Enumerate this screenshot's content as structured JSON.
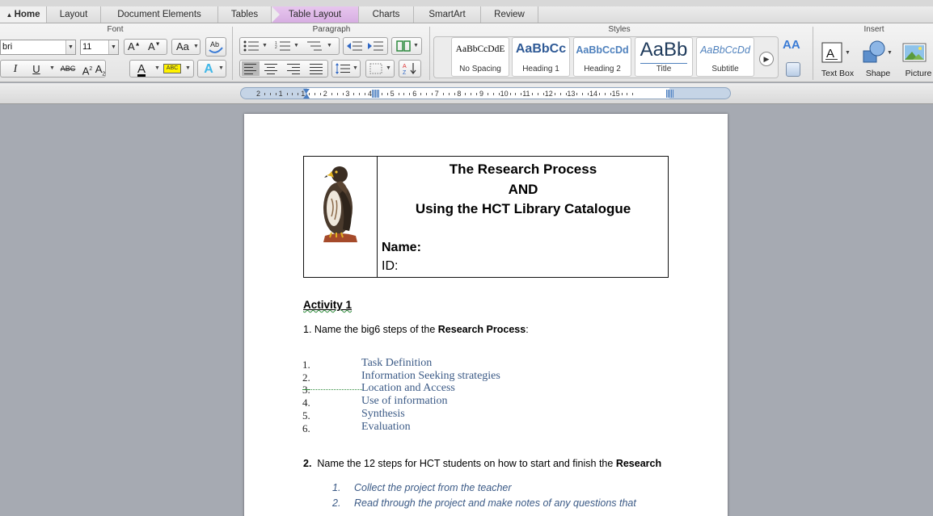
{
  "tabs": [
    {
      "label": "Home"
    },
    {
      "label": "Layout"
    },
    {
      "label": "Document Elements"
    },
    {
      "label": "Tables"
    },
    {
      "label": "Table Layout"
    },
    {
      "label": "Charts"
    },
    {
      "label": "SmartArt"
    },
    {
      "label": "Review"
    }
  ],
  "ribbon": {
    "groups": {
      "font": "Font",
      "paragraph": "Paragraph",
      "styles": "Styles",
      "insert": "Insert"
    },
    "font_name": "bri",
    "font_size": "11",
    "styles": [
      {
        "sample": "AaBbCcDdE",
        "name": "No Spacing"
      },
      {
        "sample": "AaBbCc",
        "name": "Heading 1"
      },
      {
        "sample": "AaBbCcDd",
        "name": "Heading 2"
      },
      {
        "sample": "AaBb",
        "name": "Title"
      },
      {
        "sample": "AaBbCcDd",
        "name": "Subtitle"
      }
    ],
    "insert": [
      {
        "label": "Text Box"
      },
      {
        "label": "Shape"
      },
      {
        "label": "Picture"
      }
    ]
  },
  "ruler": {
    "numbers": [
      "2",
      "1",
      "1",
      "2",
      "3",
      "4",
      "5",
      "6",
      "7",
      "8",
      "9",
      "10",
      "11",
      "12",
      "13",
      "14",
      "15"
    ]
  },
  "document": {
    "header": {
      "title1": "The Research Process",
      "title2": "AND",
      "title3": "Using the HCT Library Catalogue",
      "name_label": "Name:",
      "id_label": "ID:"
    },
    "activity_title": "Activity  1",
    "q1": {
      "prefix": "1.  Name the big6 steps of the ",
      "bold": "Research Process",
      "suffix": ":"
    },
    "big6": [
      {
        "num": "1.",
        "text": "Task Definition"
      },
      {
        "num": "2.",
        "text": "Information Seeking strategies"
      },
      {
        "num": "3.",
        "text": "Location and Access"
      },
      {
        "num": "4.",
        "text": "Use of information"
      },
      {
        "num": "5.",
        "text": "Synthesis"
      },
      {
        "num": "6.",
        "text": "Evaluation"
      }
    ],
    "q2": {
      "num": "2.",
      "prefix": "Name the 12 steps for HCT students on how to start and finish the ",
      "bold": "Research"
    },
    "hct_steps": [
      {
        "num": "1.",
        "text": "Collect the project from the teacher"
      },
      {
        "num": "2.",
        "text": "Read through the project and make notes of any questions that"
      }
    ]
  }
}
